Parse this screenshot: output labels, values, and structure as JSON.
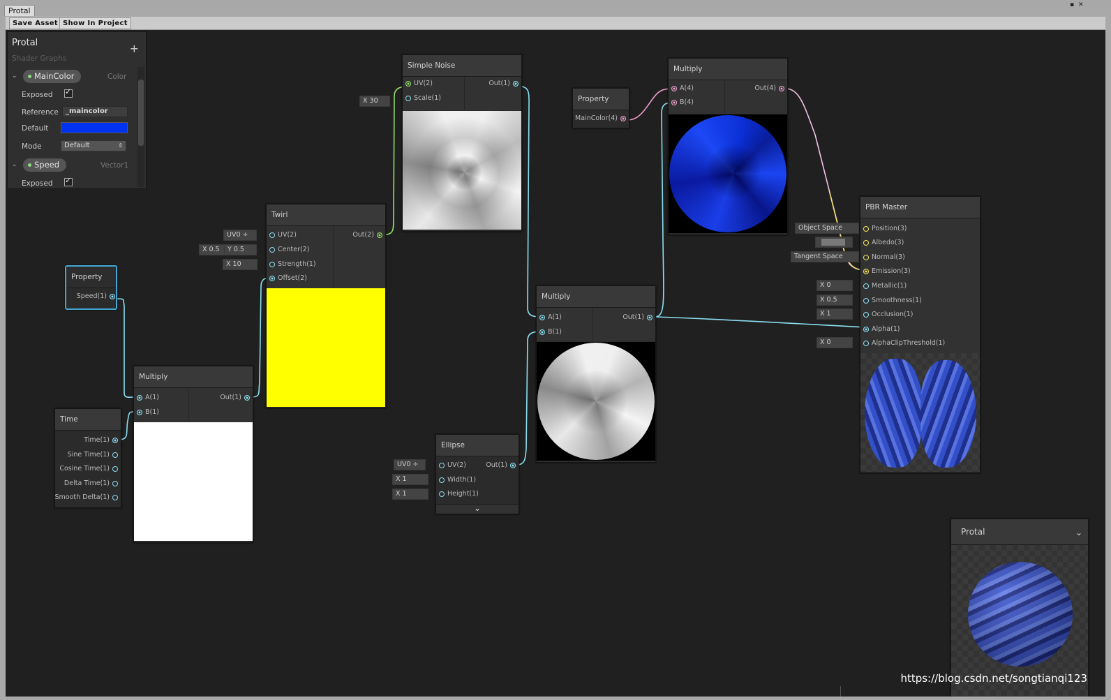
{
  "window": {
    "tab_title": "Protal",
    "close_glyph": "✕",
    "menu_glyph": "▪"
  },
  "toolbar": {
    "save_asset": "Save Asset",
    "show_in_project": "Show In Project"
  },
  "blackboard": {
    "title": "Protal",
    "subtitle": "Shader Graphs",
    "add_glyph": "+",
    "props": [
      {
        "name": "MainColor",
        "type": "Color"
      },
      {
        "name": "Speed",
        "type": "Vector1"
      }
    ],
    "labels": {
      "exposed": "Exposed",
      "reference": "Reference",
      "default": "Default",
      "mode": "Mode"
    },
    "reference_value": "_maincolor",
    "default_color": "#0033f0",
    "mode_value": "Default"
  },
  "nodes": {
    "simple_noise": {
      "title": "Simple Noise",
      "in": [
        "UV(2)",
        "Scale(1)"
      ],
      "out": "Out(1)",
      "scale_value": "X  30"
    },
    "property_color": {
      "title": "Property",
      "out": "MainColor(4)"
    },
    "multiply_color": {
      "title": "Multiply",
      "in": [
        "A(4)",
        "B(4)"
      ],
      "out": "Out(4)"
    },
    "twirl": {
      "title": "Twirl",
      "in": [
        "UV(2)",
        "Center(2)",
        "Strength(1)",
        "Offset(2)"
      ],
      "out": "Out(2)",
      "uv_value": "UV0 ÷",
      "center_x": "X  0.5",
      "center_y": "Y  0.5",
      "strength_value": "X  10"
    },
    "property_speed": {
      "title": "Property",
      "out": "Speed(1)"
    },
    "multiply_time": {
      "title": "Multiply",
      "in": [
        "A(1)",
        "B(1)"
      ],
      "out": "Out(1)"
    },
    "time": {
      "title": "Time",
      "outs": [
        "Time(1)",
        "Sine Time(1)",
        "Cosine Time(1)",
        "Delta Time(1)",
        "Smooth Delta(1)"
      ]
    },
    "multiply_mask": {
      "title": "Multiply",
      "in": [
        "A(1)",
        "B(1)"
      ],
      "out": "Out(1)"
    },
    "ellipse": {
      "title": "Ellipse",
      "in": [
        "UV(2)",
        "Width(1)",
        "Height(1)"
      ],
      "out": "Out(1)",
      "uv_value": "UV0 ÷",
      "width_value": "X  1",
      "height_value": "X  1",
      "expand_glyph": "⌄"
    },
    "pbr_master": {
      "title": "PBR Master",
      "in": [
        "Position(3)",
        "Albedo(3)",
        "Normal(3)",
        "Emission(3)",
        "Metallic(1)",
        "Smoothness(1)",
        "Occlusion(1)",
        "Alpha(1)",
        "AlphaClipThreshold(1)"
      ],
      "values": [
        "Object Space",
        "",
        "Tangent Space",
        "",
        "X  0",
        "X  0.5",
        "X  1",
        "",
        "X  0"
      ]
    }
  },
  "main_preview": {
    "title": "Protal",
    "chevron": "⌄"
  },
  "watermark": "https://blog.csdn.net/songtianqi123"
}
